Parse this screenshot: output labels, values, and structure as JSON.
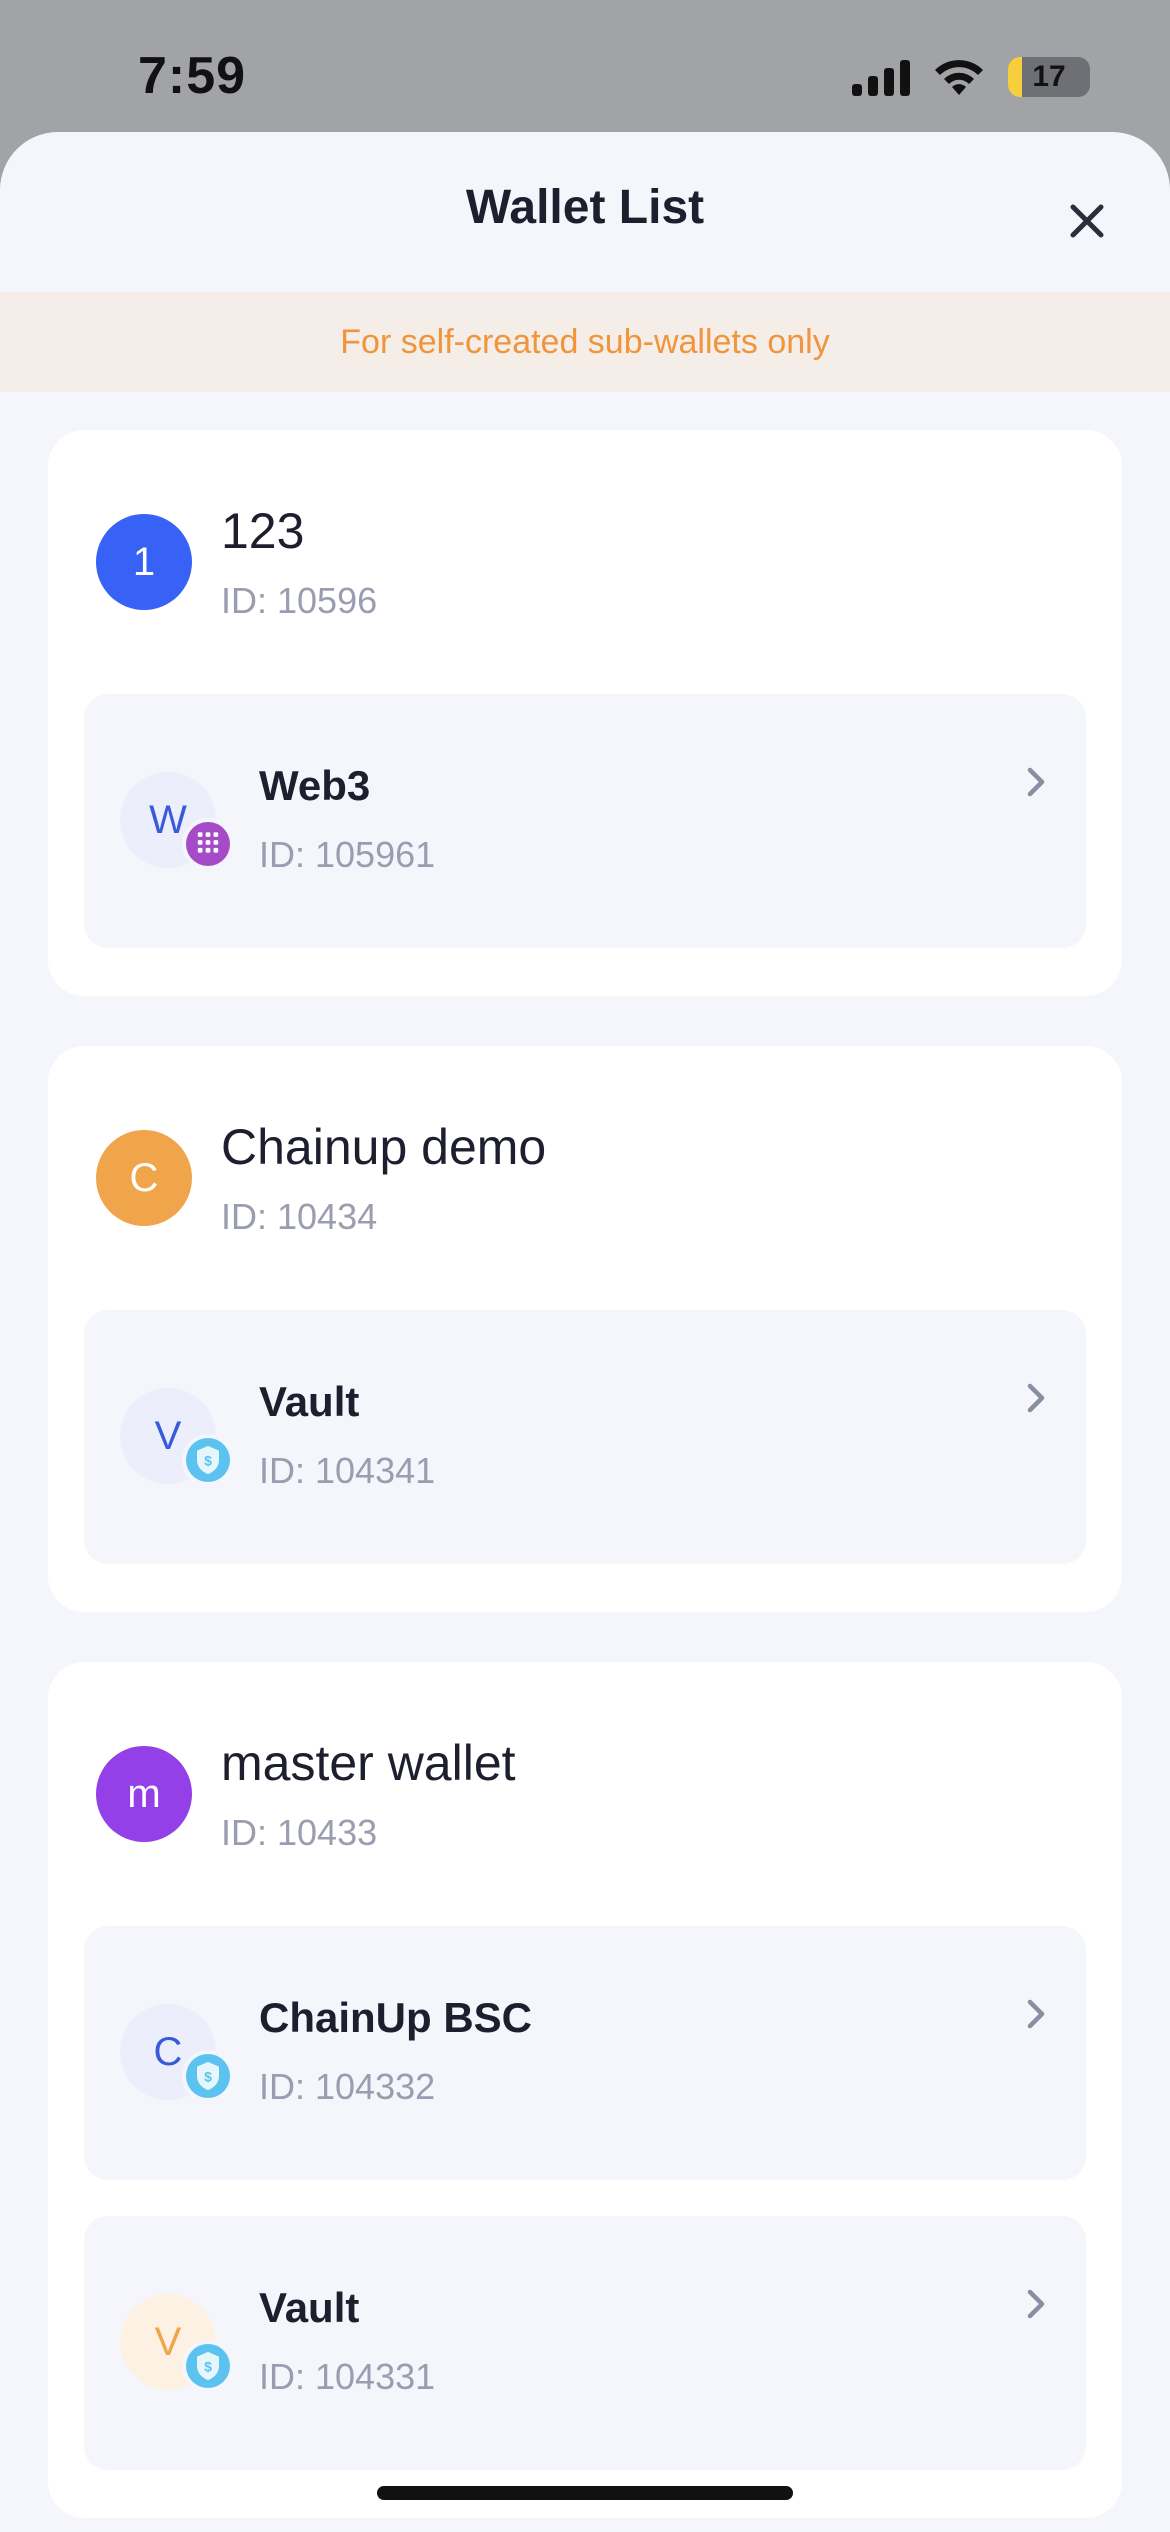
{
  "status_bar": {
    "time": "7:59",
    "battery": "17",
    "battery_level": 0.17,
    "icons": [
      "signal-icon",
      "wifi-icon",
      "battery-icon"
    ]
  },
  "header": {
    "title": "Wallet List",
    "close_icon": "close-icon"
  },
  "notice": {
    "text": "For self-created sub-wallets only",
    "color": "#f0953c"
  },
  "wallets": [
    {
      "initial": "1",
      "name": "123",
      "id": "ID: 10596",
      "color": "#3861f5",
      "subs": [
        {
          "initial": "W",
          "name": "Web3",
          "id": "ID: 105961",
          "badge": "grid-badge-icon",
          "avatar_bg": "#eceffb",
          "avatar_fg": "#3a5bd9",
          "badge_color": "#a54bc8"
        }
      ]
    },
    {
      "initial": "C",
      "name": "Chainup demo",
      "id": "ID: 10434",
      "color": "#f0a54a",
      "subs": [
        {
          "initial": "V",
          "name": "Vault",
          "id": "ID: 104341",
          "badge": "shield-dollar-icon",
          "avatar_bg": "#eceffb",
          "avatar_fg": "#3a5bd9",
          "badge_color": "#5cc2f0"
        }
      ]
    },
    {
      "initial": "m",
      "name": "master wallet",
      "id": "ID: 10433",
      "color": "#9340e8",
      "subs": [
        {
          "initial": "C",
          "name": "ChainUp BSC",
          "id": "ID: 104332",
          "badge": "shield-dollar-icon",
          "avatar_bg": "#eceffb",
          "avatar_fg": "#3a5bd9",
          "badge_color": "#5cc2f0"
        },
        {
          "initial": "V",
          "name": "Vault",
          "id": "ID: 104331",
          "badge": "shield-dollar-icon",
          "avatar_bg": "#fdf1e4",
          "avatar_fg": "#f0a54a",
          "badge_color": "#5cc2f0"
        }
      ]
    }
  ]
}
